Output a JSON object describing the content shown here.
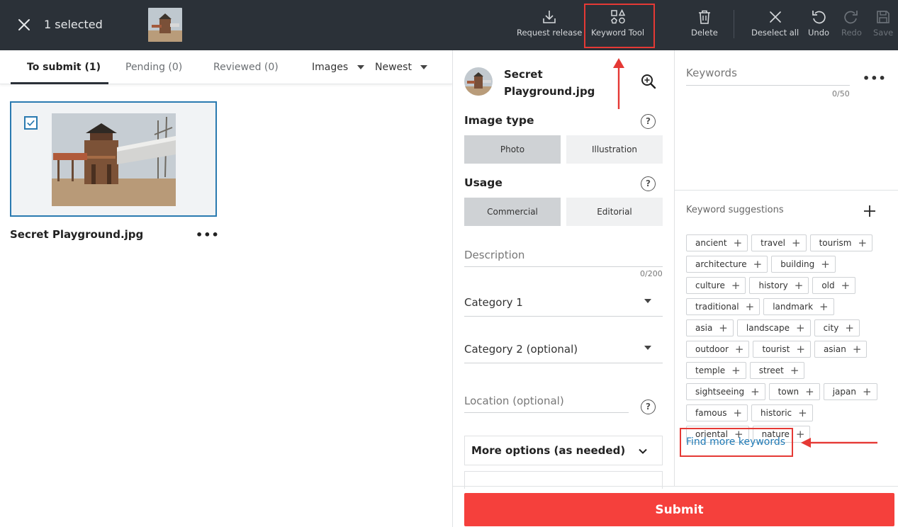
{
  "topbar": {
    "selected_text": "1 selected",
    "tools": {
      "request_release": "Request release",
      "keyword_tool": "Keyword Tool",
      "delete": "Delete",
      "deselect_all": "Deselect all",
      "undo": "Undo",
      "redo": "Redo",
      "save": "Save"
    },
    "disabled_tools": [
      "Redo",
      "Save"
    ]
  },
  "tabs": {
    "to_submit": "To submit (1)",
    "pending": "Pending (0)",
    "reviewed": "Reviewed (0)",
    "active": "To submit (1)"
  },
  "filters": {
    "media_type": "Images",
    "sort": "Newest"
  },
  "grid": {
    "items": [
      {
        "filename": "Secret Playground.jpg",
        "selected": true
      }
    ]
  },
  "details": {
    "filename": "Secret Playground.jpg",
    "image_type": {
      "label": "Image type",
      "options": [
        "Photo",
        "Illustration"
      ],
      "selected": "Photo"
    },
    "usage": {
      "label": "Usage",
      "options": [
        "Commercial",
        "Editorial"
      ],
      "selected": "Commercial"
    },
    "description": {
      "placeholder": "Description",
      "counter": "0/200"
    },
    "category1": {
      "placeholder": "Category 1"
    },
    "category2": {
      "placeholder": "Category 2 (optional)"
    },
    "location": {
      "placeholder": "Location (optional)"
    },
    "more_options": "More options (as needed)",
    "help_glyph": "?"
  },
  "keywords": {
    "placeholder": "Keywords",
    "counter": "0/50",
    "suggestions_label": "Keyword suggestions",
    "suggestions": [
      "ancient",
      "travel",
      "tourism",
      "architecture",
      "building",
      "culture",
      "history",
      "old",
      "traditional",
      "landmark",
      "asia",
      "landscape",
      "city",
      "outdoor",
      "tourist",
      "asian",
      "temple",
      "street",
      "sightseeing",
      "town",
      "japan",
      "famous",
      "historic",
      "oriental",
      "nature"
    ],
    "find_more": "Find more keywords"
  },
  "submit_label": "Submit",
  "colors": {
    "topbar": "#2b3138",
    "accent_blue": "#2a7ab0",
    "link_blue": "#1f7ab6",
    "submit_red": "#f5403c",
    "annotation_red": "#e53935",
    "selected_segment": "#cfd2d5"
  },
  "icons": {
    "close": "close-icon",
    "request_release": "download-icon",
    "keyword_tool": "shapes-icon",
    "delete": "trash-icon",
    "deselect_all": "x-icon",
    "undo": "undo-icon",
    "redo": "redo-icon",
    "save": "floppy-icon",
    "zoom": "zoom-in-icon"
  }
}
